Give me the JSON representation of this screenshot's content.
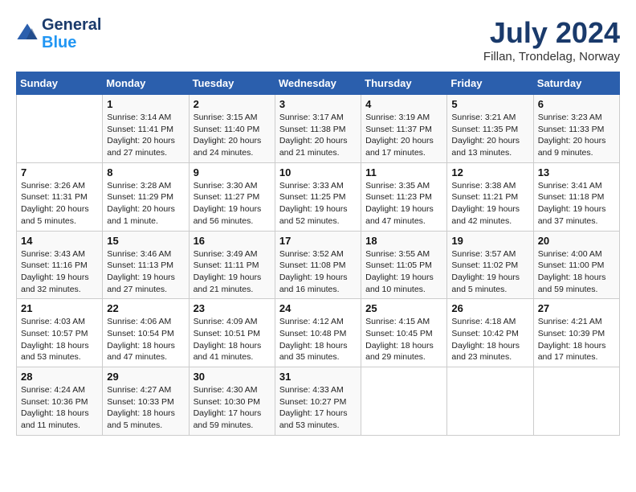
{
  "header": {
    "logo_line1": "General",
    "logo_line2": "Blue",
    "month_year": "July 2024",
    "location": "Fillan, Trondelag, Norway"
  },
  "weekdays": [
    "Sunday",
    "Monday",
    "Tuesday",
    "Wednesday",
    "Thursday",
    "Friday",
    "Saturday"
  ],
  "weeks": [
    [
      {
        "day": "",
        "info": ""
      },
      {
        "day": "1",
        "info": "Sunrise: 3:14 AM\nSunset: 11:41 PM\nDaylight: 20 hours\nand 27 minutes."
      },
      {
        "day": "2",
        "info": "Sunrise: 3:15 AM\nSunset: 11:40 PM\nDaylight: 20 hours\nand 24 minutes."
      },
      {
        "day": "3",
        "info": "Sunrise: 3:17 AM\nSunset: 11:38 PM\nDaylight: 20 hours\nand 21 minutes."
      },
      {
        "day": "4",
        "info": "Sunrise: 3:19 AM\nSunset: 11:37 PM\nDaylight: 20 hours\nand 17 minutes."
      },
      {
        "day": "5",
        "info": "Sunrise: 3:21 AM\nSunset: 11:35 PM\nDaylight: 20 hours\nand 13 minutes."
      },
      {
        "day": "6",
        "info": "Sunrise: 3:23 AM\nSunset: 11:33 PM\nDaylight: 20 hours\nand 9 minutes."
      }
    ],
    [
      {
        "day": "7",
        "info": "Sunrise: 3:26 AM\nSunset: 11:31 PM\nDaylight: 20 hours\nand 5 minutes."
      },
      {
        "day": "8",
        "info": "Sunrise: 3:28 AM\nSunset: 11:29 PM\nDaylight: 20 hours\nand 1 minute."
      },
      {
        "day": "9",
        "info": "Sunrise: 3:30 AM\nSunset: 11:27 PM\nDaylight: 19 hours\nand 56 minutes."
      },
      {
        "day": "10",
        "info": "Sunrise: 3:33 AM\nSunset: 11:25 PM\nDaylight: 19 hours\nand 52 minutes."
      },
      {
        "day": "11",
        "info": "Sunrise: 3:35 AM\nSunset: 11:23 PM\nDaylight: 19 hours\nand 47 minutes."
      },
      {
        "day": "12",
        "info": "Sunrise: 3:38 AM\nSunset: 11:21 PM\nDaylight: 19 hours\nand 42 minutes."
      },
      {
        "day": "13",
        "info": "Sunrise: 3:41 AM\nSunset: 11:18 PM\nDaylight: 19 hours\nand 37 minutes."
      }
    ],
    [
      {
        "day": "14",
        "info": "Sunrise: 3:43 AM\nSunset: 11:16 PM\nDaylight: 19 hours\nand 32 minutes."
      },
      {
        "day": "15",
        "info": "Sunrise: 3:46 AM\nSunset: 11:13 PM\nDaylight: 19 hours\nand 27 minutes."
      },
      {
        "day": "16",
        "info": "Sunrise: 3:49 AM\nSunset: 11:11 PM\nDaylight: 19 hours\nand 21 minutes."
      },
      {
        "day": "17",
        "info": "Sunrise: 3:52 AM\nSunset: 11:08 PM\nDaylight: 19 hours\nand 16 minutes."
      },
      {
        "day": "18",
        "info": "Sunrise: 3:55 AM\nSunset: 11:05 PM\nDaylight: 19 hours\nand 10 minutes."
      },
      {
        "day": "19",
        "info": "Sunrise: 3:57 AM\nSunset: 11:02 PM\nDaylight: 19 hours\nand 5 minutes."
      },
      {
        "day": "20",
        "info": "Sunrise: 4:00 AM\nSunset: 11:00 PM\nDaylight: 18 hours\nand 59 minutes."
      }
    ],
    [
      {
        "day": "21",
        "info": "Sunrise: 4:03 AM\nSunset: 10:57 PM\nDaylight: 18 hours\nand 53 minutes."
      },
      {
        "day": "22",
        "info": "Sunrise: 4:06 AM\nSunset: 10:54 PM\nDaylight: 18 hours\nand 47 minutes."
      },
      {
        "day": "23",
        "info": "Sunrise: 4:09 AM\nSunset: 10:51 PM\nDaylight: 18 hours\nand 41 minutes."
      },
      {
        "day": "24",
        "info": "Sunrise: 4:12 AM\nSunset: 10:48 PM\nDaylight: 18 hours\nand 35 minutes."
      },
      {
        "day": "25",
        "info": "Sunrise: 4:15 AM\nSunset: 10:45 PM\nDaylight: 18 hours\nand 29 minutes."
      },
      {
        "day": "26",
        "info": "Sunrise: 4:18 AM\nSunset: 10:42 PM\nDaylight: 18 hours\nand 23 minutes."
      },
      {
        "day": "27",
        "info": "Sunrise: 4:21 AM\nSunset: 10:39 PM\nDaylight: 18 hours\nand 17 minutes."
      }
    ],
    [
      {
        "day": "28",
        "info": "Sunrise: 4:24 AM\nSunset: 10:36 PM\nDaylight: 18 hours\nand 11 minutes."
      },
      {
        "day": "29",
        "info": "Sunrise: 4:27 AM\nSunset: 10:33 PM\nDaylight: 18 hours\nand 5 minutes."
      },
      {
        "day": "30",
        "info": "Sunrise: 4:30 AM\nSunset: 10:30 PM\nDaylight: 17 hours\nand 59 minutes."
      },
      {
        "day": "31",
        "info": "Sunrise: 4:33 AM\nSunset: 10:27 PM\nDaylight: 17 hours\nand 53 minutes."
      },
      {
        "day": "",
        "info": ""
      },
      {
        "day": "",
        "info": ""
      },
      {
        "day": "",
        "info": ""
      }
    ]
  ]
}
